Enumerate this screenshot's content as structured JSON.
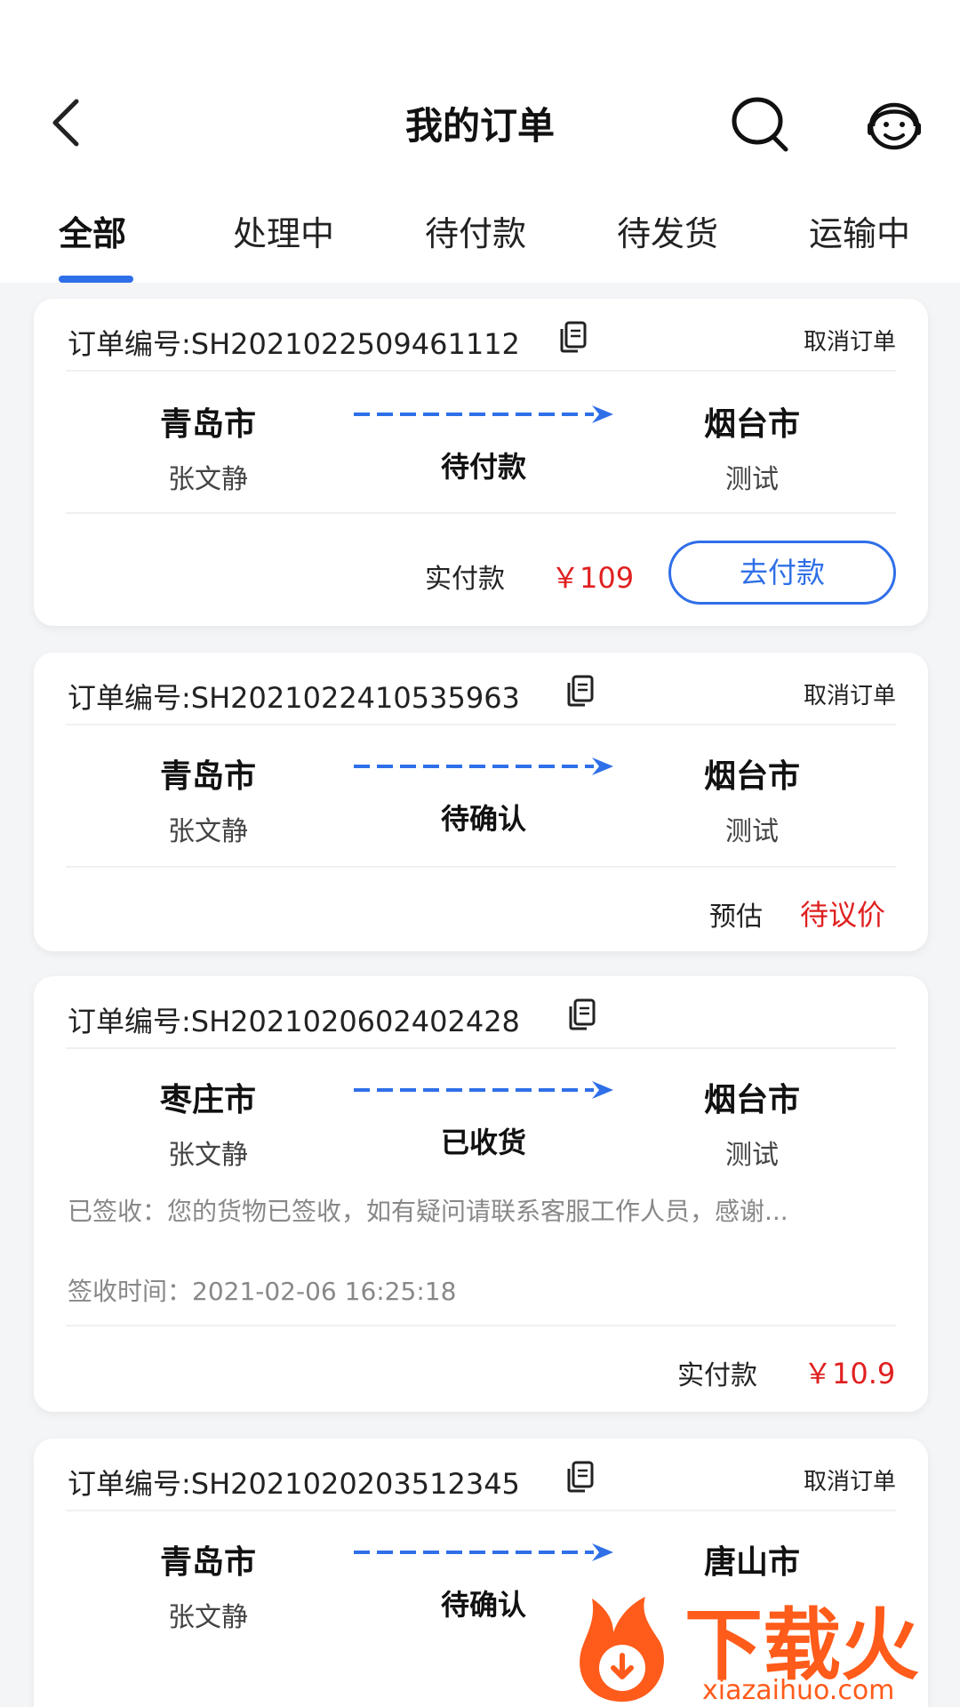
{
  "header": {
    "title": "我的订单",
    "back_icon": "chevron-left-icon",
    "search_icon": "search-icon",
    "service_icon": "customer-service-icon"
  },
  "tabs": [
    {
      "label": "全部",
      "active": true
    },
    {
      "label": "处理中",
      "active": false
    },
    {
      "label": "待付款",
      "active": false
    },
    {
      "label": "待发货",
      "active": false
    },
    {
      "label": "运输中",
      "active": false
    }
  ],
  "orders": [
    {
      "order_no": "订单编号:SH2021022509461112",
      "cancel_label": "取消订单",
      "from_city": "青岛市",
      "from_person": "张文静",
      "to_city": "烟台市",
      "to_person": "测试",
      "status": "待付款",
      "pay_label": "实付款",
      "pay_amount": "￥109",
      "action_label": "去付款"
    },
    {
      "order_no": "订单编号:SH2021022410535963",
      "cancel_label": "取消订单",
      "from_city": "青岛市",
      "from_person": "张文静",
      "to_city": "烟台市",
      "to_person": "测试",
      "status": "待确认",
      "pay_label": "预估",
      "pay_amount": "待议价"
    },
    {
      "order_no": "订单编号:SH2021020602402428",
      "from_city": "枣庄市",
      "from_person": "张文静",
      "to_city": "烟台市",
      "to_person": "测试",
      "status": "已收货",
      "note": "已签收：您的货物已签收，如有疑问请联系客服工作人员，感谢...",
      "sign_time": "签收时间：2021-02-06 16:25:18",
      "pay_label": "实付款",
      "pay_amount": "￥10.9"
    },
    {
      "order_no": "订单编号:SH2021020203512345",
      "cancel_label": "取消订单",
      "from_city": "青岛市",
      "from_person": "张文静",
      "to_city": "唐山市",
      "status": "待确认"
    }
  ],
  "watermark": {
    "brand": "下载火",
    "url": "xiazaihuo.com"
  },
  "colors": {
    "accent": "#2f6fe8",
    "price": "#e02020",
    "background": "#f4f5f7"
  }
}
